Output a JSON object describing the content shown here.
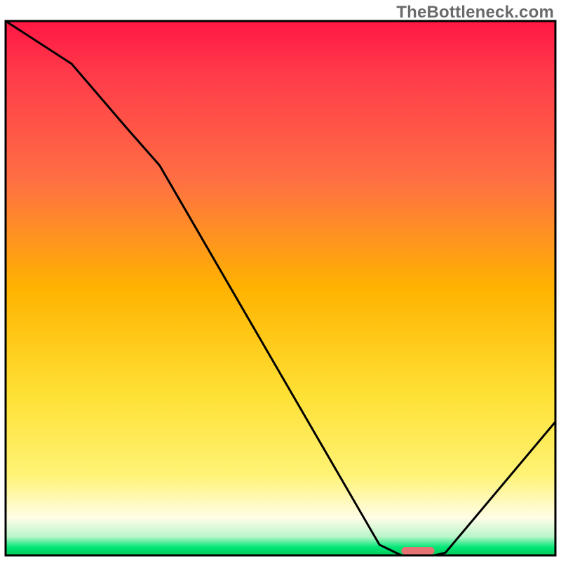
{
  "watermark": "TheBottleneck.com",
  "chart_data": {
    "type": "line",
    "title": "",
    "xlabel": "",
    "ylabel": "",
    "xlim": [
      0,
      100
    ],
    "ylim": [
      0,
      100
    ],
    "x": [
      0,
      12,
      22,
      28,
      68,
      72,
      78,
      80,
      100
    ],
    "values": [
      100,
      92,
      80,
      73,
      2,
      0,
      0,
      0.5,
      25
    ],
    "optimum_marker": {
      "x_start": 72,
      "x_end": 78,
      "color": "#e57373"
    },
    "background": {
      "type": "vertical-gradient",
      "stops": [
        {
          "offset": 0.0,
          "color": "#ff1744"
        },
        {
          "offset": 0.1,
          "color": "#ff3b4a"
        },
        {
          "offset": 0.3,
          "color": "#ff7043"
        },
        {
          "offset": 0.5,
          "color": "#ffb300"
        },
        {
          "offset": 0.7,
          "color": "#ffe135"
        },
        {
          "offset": 0.85,
          "color": "#fff376"
        },
        {
          "offset": 0.93,
          "color": "#fffde7"
        },
        {
          "offset": 0.965,
          "color": "#b9f6ca"
        },
        {
          "offset": 0.985,
          "color": "#00e676"
        },
        {
          "offset": 1.0,
          "color": "#00c853"
        }
      ]
    },
    "border_width": 3
  }
}
